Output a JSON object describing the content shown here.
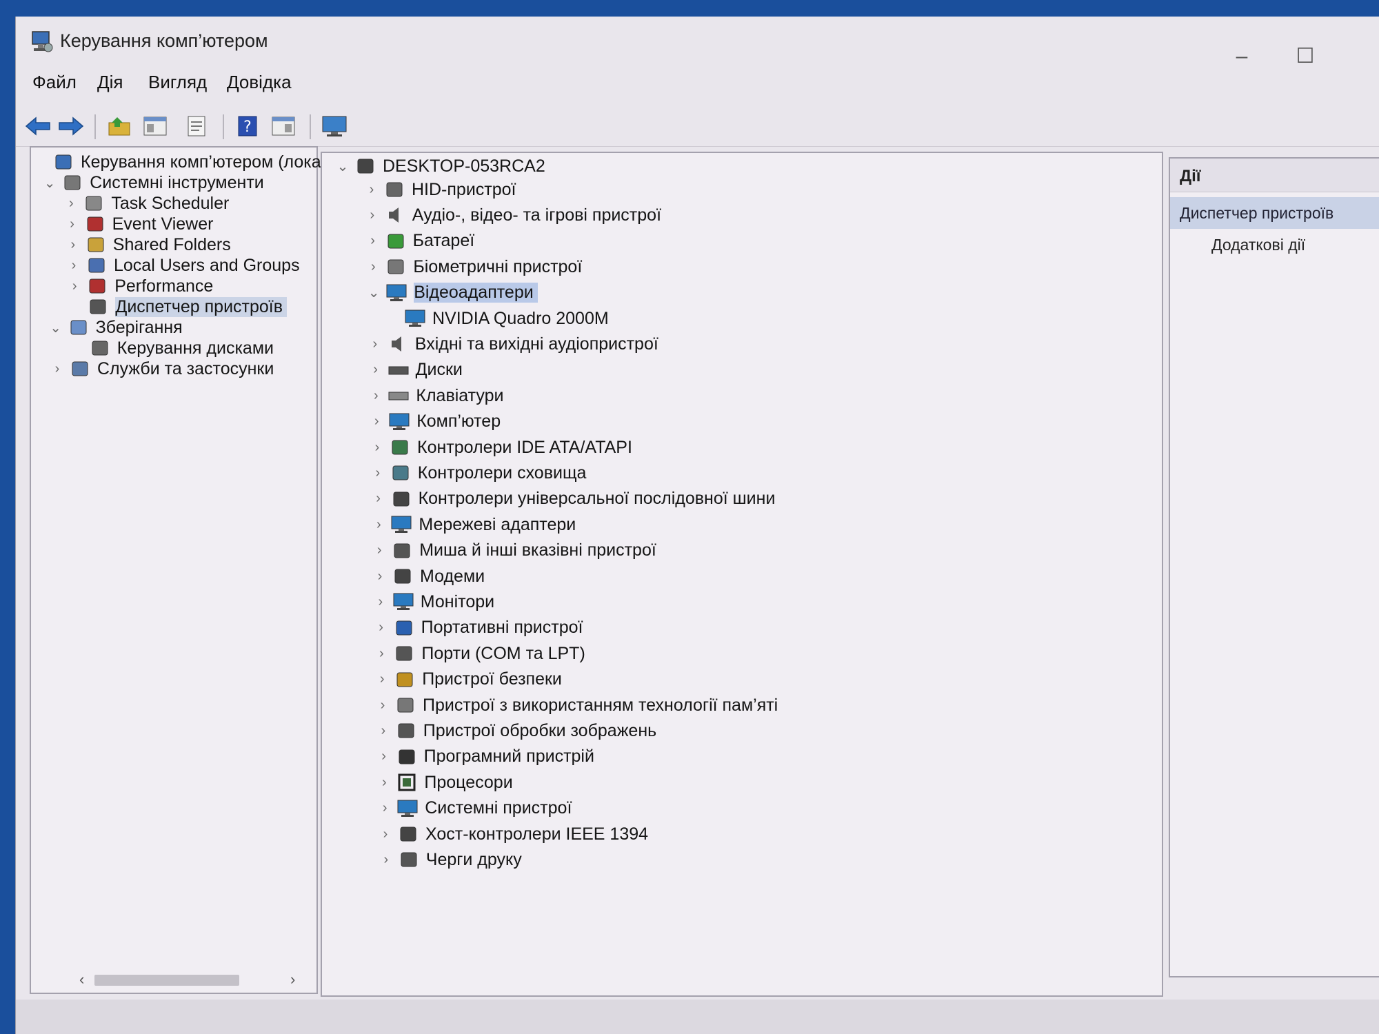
{
  "window": {
    "title": "Керування комп’ютером",
    "minimize_glyph": "–",
    "maximize_glyph": "☐"
  },
  "menu": [
    "Файл",
    "Дія",
    "Вигляд",
    "Довідка"
  ],
  "toolbar": [
    "back-arrow-icon",
    "forward-arrow-icon",
    "up-folder-icon",
    "show-hide-tree-icon",
    "properties-icon",
    "help-icon",
    "show-hide-action-pane-icon",
    "monitor-icon"
  ],
  "left_tree": [
    {
      "label": "Керування комп’ютером (лока",
      "icon": "computer-management-icon",
      "expander": "",
      "indent": 0
    },
    {
      "label": "Системні інструменти",
      "icon": "system-tools-icon",
      "expander": "⌄",
      "indent": 1
    },
    {
      "label": "Task Scheduler",
      "icon": "task-scheduler-icon",
      "expander": "›",
      "indent": 2
    },
    {
      "label": "Event Viewer",
      "icon": "event-viewer-icon",
      "expander": "›",
      "indent": 2
    },
    {
      "label": "Shared Folders",
      "icon": "shared-folders-icon",
      "expander": "›",
      "indent": 2
    },
    {
      "label": "Local Users and Groups",
      "icon": "local-users-icon",
      "expander": "›",
      "indent": 2
    },
    {
      "label": "Performance",
      "icon": "performance-icon",
      "expander": "›",
      "indent": 2
    },
    {
      "label": "Диспетчер пристроїв",
      "icon": "device-manager-icon",
      "expander": "",
      "indent": 2,
      "selected": true
    },
    {
      "label": "Зберігання",
      "icon": "storage-icon",
      "expander": "⌄",
      "indent": 1
    },
    {
      "label": "Керування дисками",
      "icon": "disk-management-icon",
      "expander": "",
      "indent": 2
    },
    {
      "label": "Служби та застосунки",
      "icon": "services-icon",
      "expander": "›",
      "indent": 1
    }
  ],
  "device_tree": {
    "root": {
      "label": "DESKTOP-053RCA2",
      "icon": "computer-icon",
      "expander": "⌄"
    },
    "items": [
      {
        "label": "HID-пристрої",
        "icon": "hid-icon",
        "expander": "›"
      },
      {
        "label": "Аудіо-, відео- та ігрові пристрої",
        "icon": "speaker-icon",
        "expander": "›"
      },
      {
        "label": "Батареї",
        "icon": "battery-icon",
        "expander": "›"
      },
      {
        "label": "Біометричні пристрої",
        "icon": "biometric-icon",
        "expander": "›"
      },
      {
        "label": "Відеоадаптери",
        "icon": "display-adapter-icon",
        "expander": "⌄",
        "selected": true
      },
      {
        "label": "NVIDIA Quadro 2000M",
        "icon": "display-adapter-icon",
        "expander": "",
        "child": true
      },
      {
        "label": "Вхідні та вихідні аудіопристрої",
        "icon": "speaker-icon",
        "expander": "›"
      },
      {
        "label": "Диски",
        "icon": "disk-drive-icon",
        "expander": "›"
      },
      {
        "label": "Клавіатури",
        "icon": "keyboard-icon",
        "expander": "›"
      },
      {
        "label": "Комп’ютер",
        "icon": "monitor-icon",
        "expander": "›"
      },
      {
        "label": "Контролери IDE ATA/ATAPI",
        "icon": "ide-controller-icon",
        "expander": "›"
      },
      {
        "label": "Контролери сховища",
        "icon": "storage-controller-icon",
        "expander": "›"
      },
      {
        "label": "Контролери універсальної послідовної шини",
        "icon": "usb-icon",
        "expander": "›"
      },
      {
        "label": "Мережеві адаптери",
        "icon": "network-adapter-icon",
        "expander": "›"
      },
      {
        "label": "Миша й інші вказівні пристрої",
        "icon": "mouse-icon",
        "expander": "›"
      },
      {
        "label": "Модеми",
        "icon": "modem-icon",
        "expander": "›"
      },
      {
        "label": "Монітори",
        "icon": "monitor-icon",
        "expander": "›"
      },
      {
        "label": "Портативні пристрої",
        "icon": "portable-device-icon",
        "expander": "›"
      },
      {
        "label": "Порти (COM та LPT)",
        "icon": "port-icon",
        "expander": "›"
      },
      {
        "label": "Пристрої безпеки",
        "icon": "security-device-icon",
        "expander": "›"
      },
      {
        "label": "Пристрої з використанням технології пам’яті",
        "icon": "memory-device-icon",
        "expander": "›"
      },
      {
        "label": "Пристрої обробки зображень",
        "icon": "camera-icon",
        "expander": "›"
      },
      {
        "label": "Програмний пристрій",
        "icon": "software-device-icon",
        "expander": "›"
      },
      {
        "label": "Процесори",
        "icon": "processor-icon",
        "expander": "›"
      },
      {
        "label": "Системні пристрої",
        "icon": "system-device-icon",
        "expander": "›"
      },
      {
        "label": "Хост-контролери IEEE 1394",
        "icon": "ieee1394-icon",
        "expander": "›"
      },
      {
        "label": "Черги друку",
        "icon": "printer-icon",
        "expander": "›"
      }
    ]
  },
  "actions": {
    "header": "Дії",
    "selected": "Диспетчер пристроїв",
    "more": "Додаткові дії"
  },
  "scrollbar": {
    "left_arrow": "‹",
    "right_arrow": "›"
  }
}
